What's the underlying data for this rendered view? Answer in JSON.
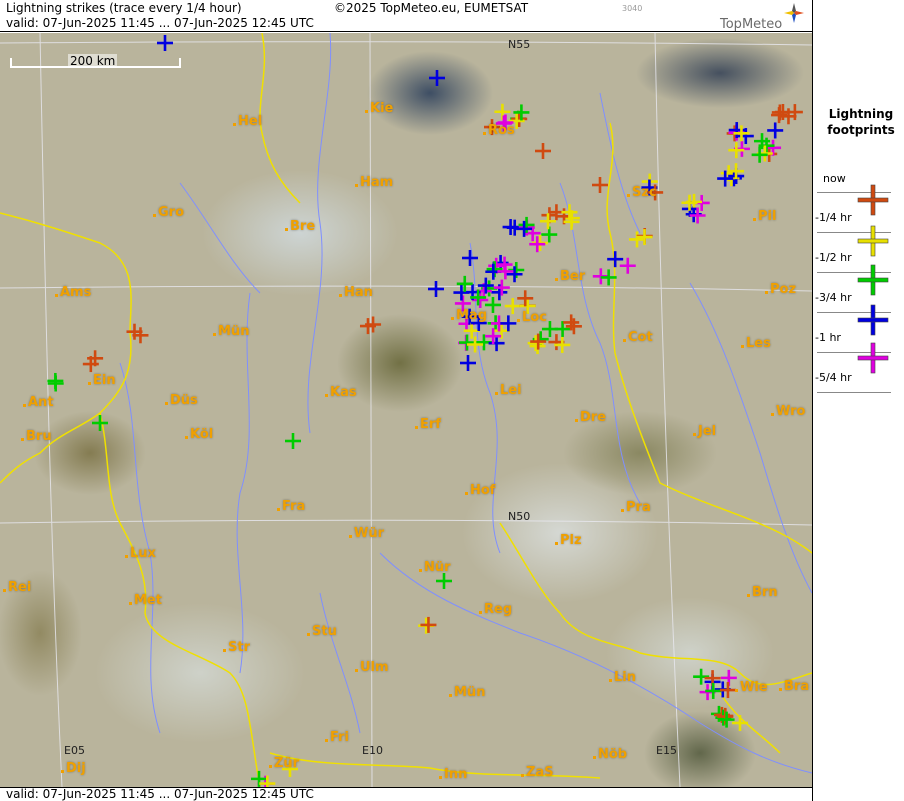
{
  "header": {
    "title": "Lightning strikes (trace every 1/4 hour)",
    "valid": "valid:  07-Jun-2025 11:45 ... 07-Jun-2025 12:45 UTC",
    "copyright": "©2025 TopMeteo.eu, EUMETSAT",
    "code": "3040",
    "logo": "TopMeteo"
  },
  "footer": {
    "valid": "valid:  07-Jun-2025 11:45 ... 07-Jun-2025 12:45 UTC"
  },
  "scale": {
    "label": "200 km"
  },
  "grid_labels": {
    "n55": "N55",
    "n50": "N50",
    "e05": "E05",
    "e10": "E10",
    "e15": "E15"
  },
  "cities": {
    "hel": "Hel",
    "kie": "Kie",
    "ros": "Ros",
    "ham": "Ham",
    "szc": "Szc",
    "gro": "Gro",
    "bre": "Bre",
    "pil": "Pil",
    "ber": "Ber",
    "ams": "Ams",
    "han": "Han",
    "poz": "Poz",
    "mag": "Mag",
    "loc": "Loc",
    "mun": "Mün",
    "cot": "Cot",
    "les": "Les",
    "ein": "Ein",
    "kas": "Kas",
    "lei": "Lei",
    "ant": "Ant",
    "dus": "Düs",
    "dre": "Dre",
    "wro": "Wro",
    "bru": "Bru",
    "kol": "Köl",
    "erf": "Erf",
    "jel": "Jel",
    "hof": "Hof",
    "fra": "Fra",
    "pra": "Pra",
    "wur": "Wür",
    "plz": "Plz",
    "lux": "Lux",
    "nur": "Nür",
    "rei": "Rei",
    "met": "Met",
    "brn": "Brn",
    "reg": "Reg",
    "str": "Str",
    "stu": "Stu",
    "ulm": "Ulm",
    "lin": "Lin",
    "wie": "Wie",
    "bra": "Bra",
    "mun2": "Mün",
    "fri": "Fri",
    "nob": "Nöb",
    "dij": "Dij",
    "zur": "Zür",
    "inn": "Inn",
    "zas": "ZaS"
  },
  "legend": {
    "title": "Lightning footprints",
    "entries": [
      {
        "label": "now"
      },
      {
        "label": "-1/4 hr",
        "color": "#d04a10"
      },
      {
        "label": "-1/2 hr",
        "color": "#e8e000"
      },
      {
        "label": "-3/4 hr",
        "color": "#00cc00"
      },
      {
        "label": "-1 hr",
        "color": "#0000e0"
      },
      {
        "label": "-5/4 hr",
        "color": "#e000e0"
      }
    ]
  },
  "colors": {
    "quarter": "#d04a10",
    "half": "#e8e000",
    "three_quarter": "#00cc00",
    "hour": "#0000e0",
    "five_quarter": "#e000e0",
    "border": "#f0e000",
    "river": "#7f8fff",
    "city": "#f0a000"
  }
}
